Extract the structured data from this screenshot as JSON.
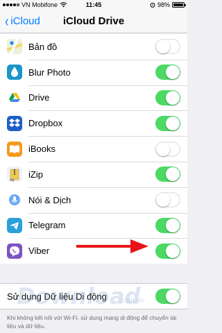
{
  "status_bar": {
    "carrier": "VN Mobifone",
    "time": "11:45",
    "battery_text": "98%",
    "battery_level": 0.98
  },
  "nav": {
    "back_label": "iCloud",
    "title": "iCloud Drive"
  },
  "apps": [
    {
      "label": "Bản đồ",
      "icon": "maps-icon",
      "on": false
    },
    {
      "label": "Blur Photo",
      "icon": "blur-photo-icon",
      "on": true
    },
    {
      "label": "Drive",
      "icon": "google-drive-icon",
      "on": true
    },
    {
      "label": "Dropbox",
      "icon": "dropbox-icon",
      "on": true
    },
    {
      "label": "iBooks",
      "icon": "ibooks-icon",
      "on": false
    },
    {
      "label": "iZip",
      "icon": "izip-icon",
      "on": true
    },
    {
      "label": "Nói & Dịch",
      "icon": "speak-translate-icon",
      "on": false
    },
    {
      "label": "Telegram",
      "icon": "telegram-icon",
      "on": true
    },
    {
      "label": "Viber",
      "icon": "viber-icon",
      "on": true
    }
  ],
  "cellular": {
    "label": "Sử dụng Dữ liệu Di động",
    "on": true
  },
  "footer_text": "Khi không kết nối với Wi-Fi, sử dụng mạng di động để chuyển tài liệu và dữ liệu.",
  "watermark": {
    "main": "Download",
    "sub": ".com.vn"
  },
  "colors": {
    "accent": "#007aff",
    "toggle_on": "#4cd964",
    "arrow": "#e8141b"
  }
}
